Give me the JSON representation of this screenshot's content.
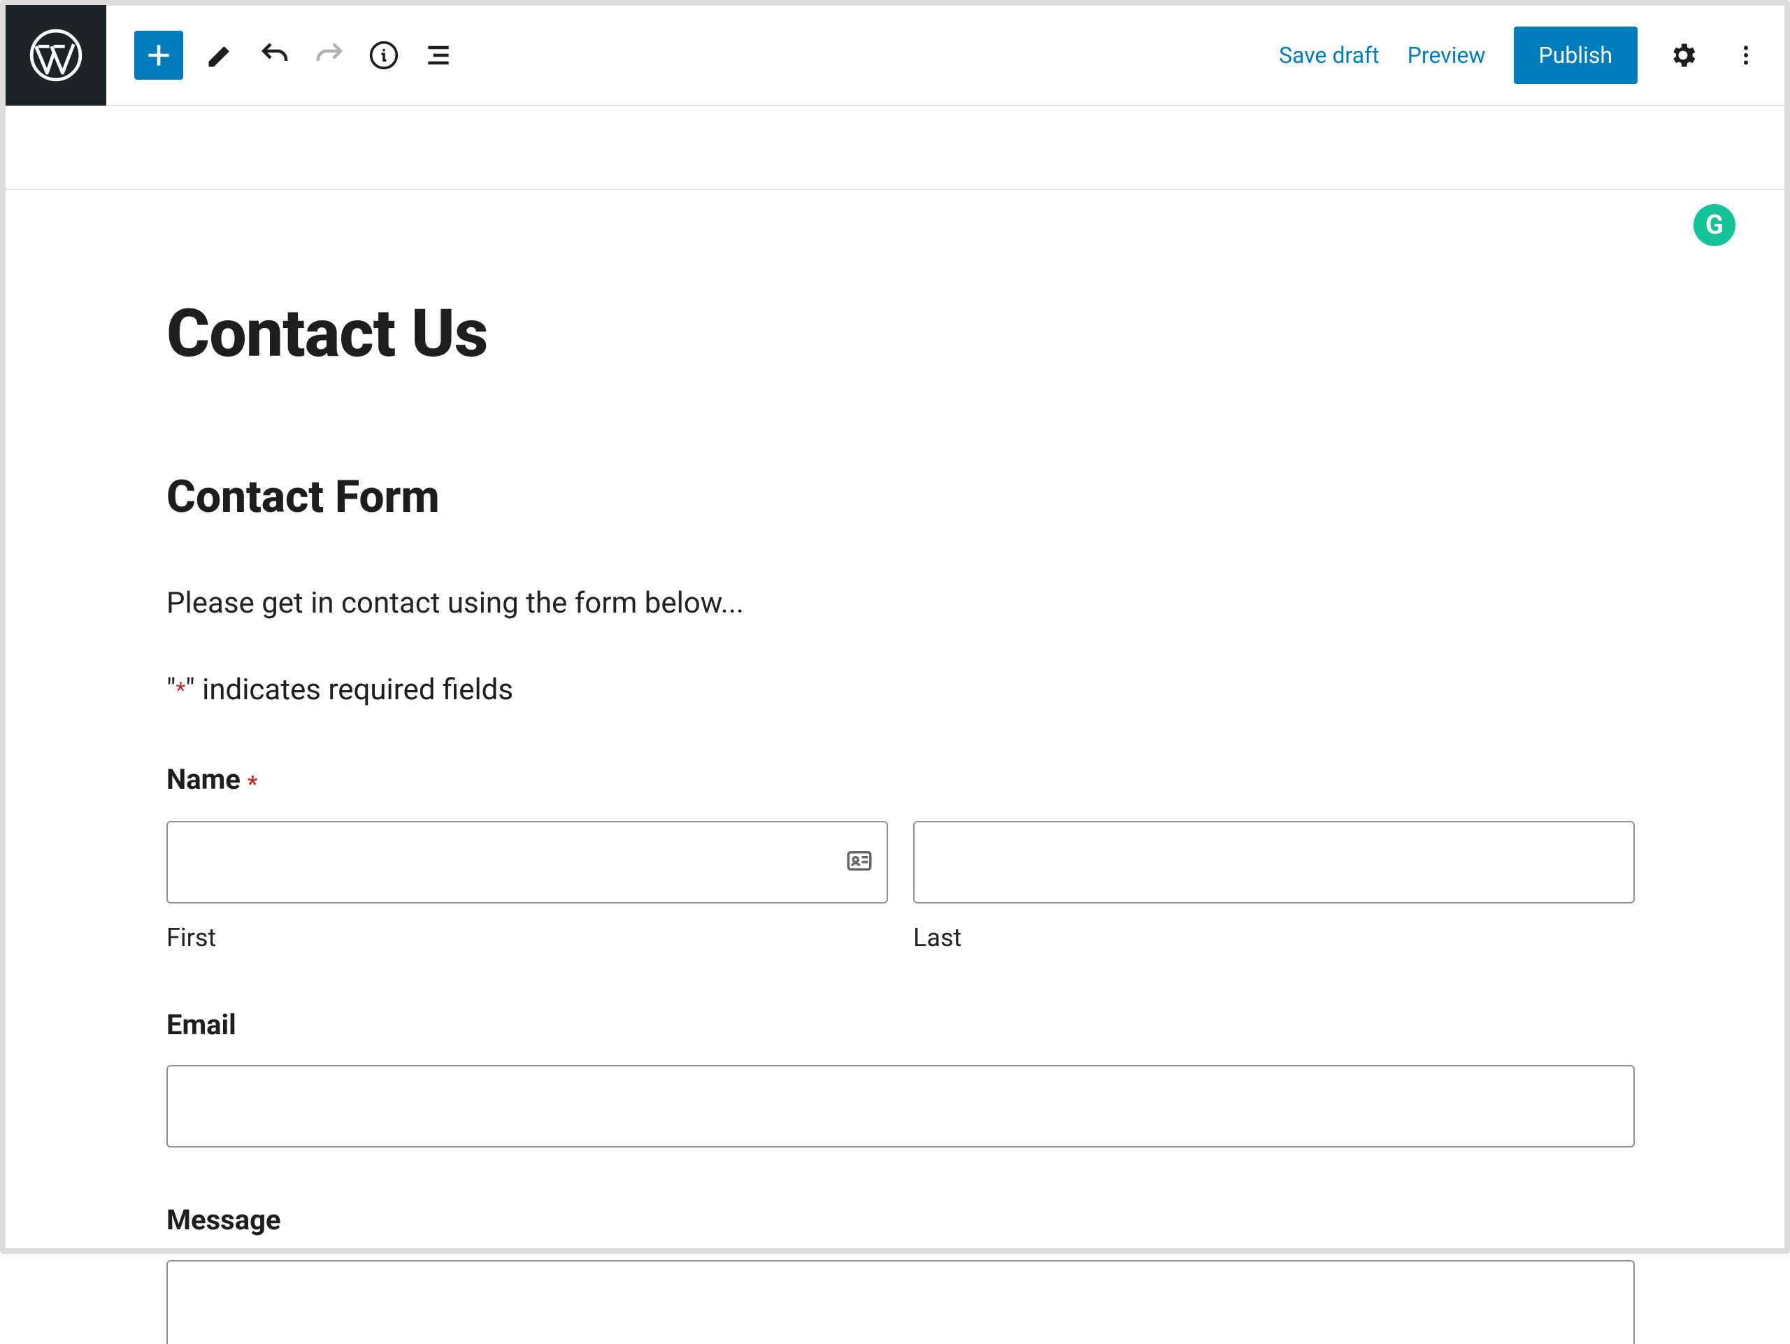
{
  "toolbar": {
    "save_draft": "Save draft",
    "preview": "Preview",
    "publish": "Publish"
  },
  "page": {
    "title": "Contact Us",
    "form_heading": "Contact Form",
    "intro": "Please get in contact using the form below...",
    "required_prefix": "\"",
    "required_asterisk": "*",
    "required_suffix": "\" indicates required fields"
  },
  "fields": {
    "name_label": "Name",
    "name_asterisk": "*",
    "first_sublabel": "First",
    "last_sublabel": "Last",
    "email_label": "Email",
    "message_label": "Message"
  },
  "grammarly_badge": "G"
}
